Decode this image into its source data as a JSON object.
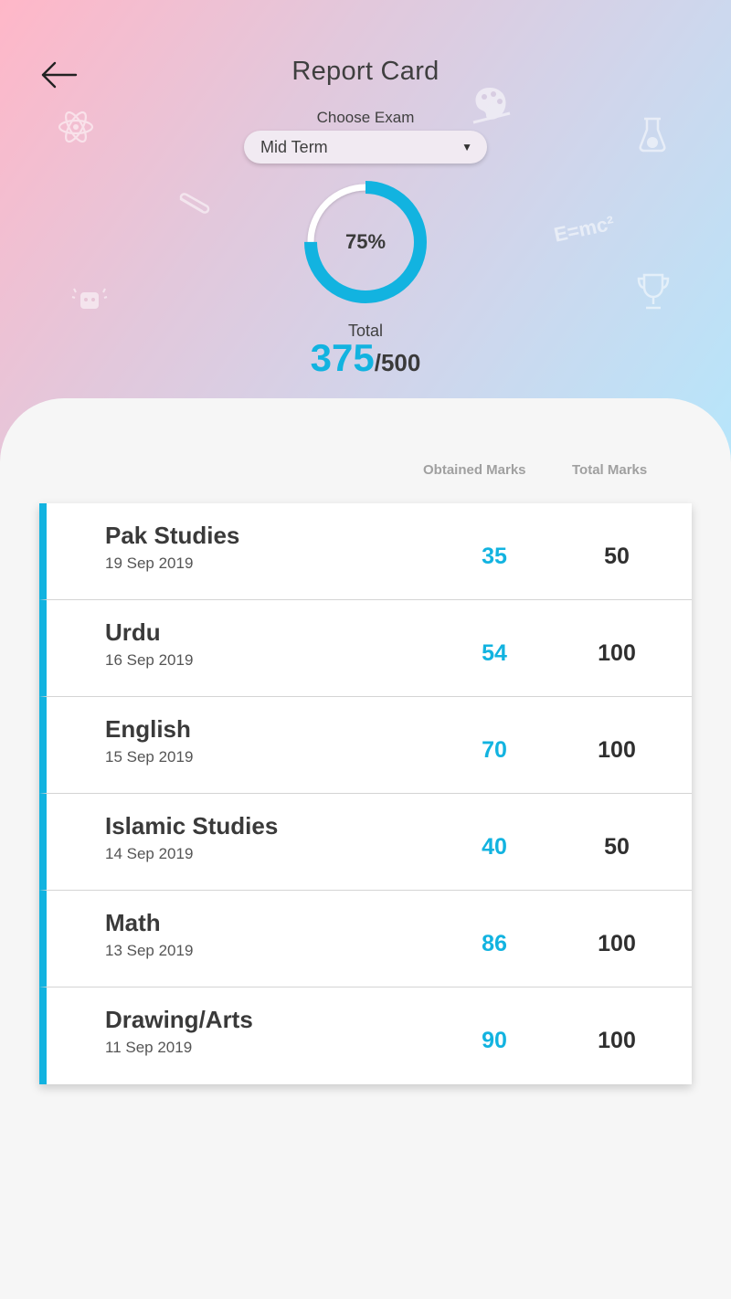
{
  "header": {
    "title": "Report Card"
  },
  "exam_picker": {
    "label": "Choose Exam",
    "selected": "Mid Term"
  },
  "summary": {
    "percent_label": "75%",
    "percent_value": 0.75,
    "total_label": "Total",
    "obtained": "375",
    "out_of": "/500"
  },
  "columns": {
    "obtained": "Obtained Marks",
    "total": "Total Marks"
  },
  "subjects": [
    {
      "name": "Pak Studies",
      "date": "19 Sep 2019",
      "obtained": "35",
      "total": "50"
    },
    {
      "name": "Urdu",
      "date": "16 Sep 2019",
      "obtained": "54",
      "total": "100"
    },
    {
      "name": "English",
      "date": "15 Sep 2019",
      "obtained": "70",
      "total": "100"
    },
    {
      "name": "Islamic Studies",
      "date": "14 Sep 2019",
      "obtained": "40",
      "total": "50"
    },
    {
      "name": "Math",
      "date": "13 Sep 2019",
      "obtained": "86",
      "total": "100"
    },
    {
      "name": "Drawing/Arts",
      "date": "11 Sep 2019",
      "obtained": "90",
      "total": "100"
    }
  ],
  "colors": {
    "accent": "#12b3e0",
    "text": "#3a3a3a"
  },
  "decor_icons": [
    "atom-icon",
    "palette-icon",
    "flask-icon",
    "paperclip-icon",
    "formula-icon",
    "trophy-icon",
    "robot-icon"
  ],
  "decor_formula": "E=mc²"
}
